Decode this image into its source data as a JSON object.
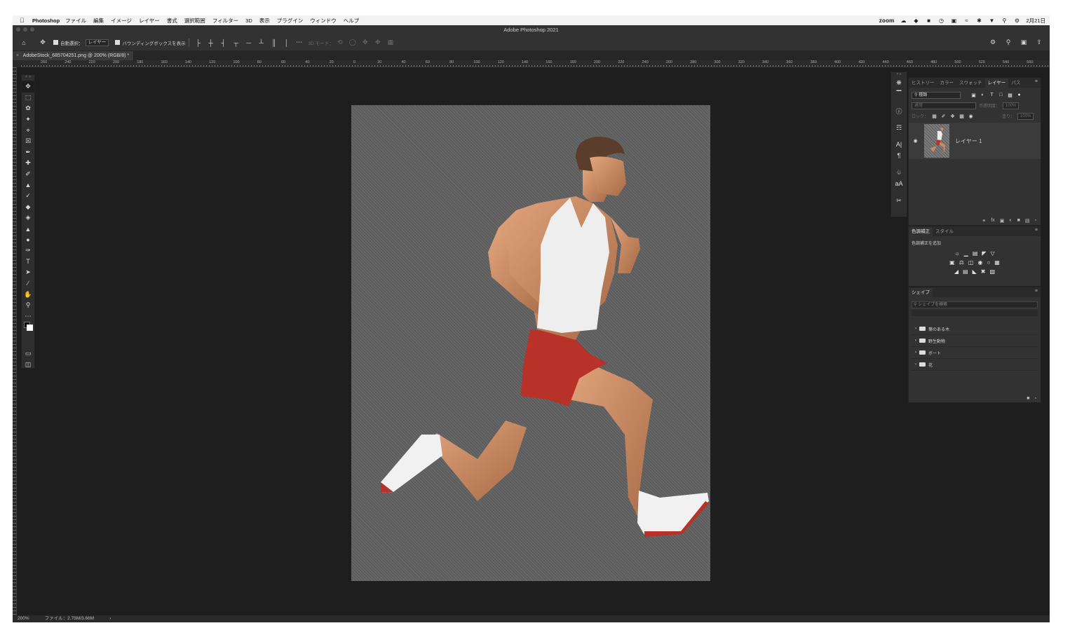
{
  "menubar": {
    "app_name": "Photoshop",
    "items": [
      "ファイル",
      "編集",
      "イメージ",
      "レイヤー",
      "書式",
      "選択範囲",
      "フィルター",
      "3D",
      "表示",
      "プラグイン",
      "ウィンドウ",
      "ヘルプ"
    ],
    "zoom_label": "zoom",
    "clock": "2月21日"
  },
  "window": {
    "title": "Adobe Photoshop 2021"
  },
  "options_bar": {
    "auto_select_label": "自動選択：",
    "auto_select_target": "レイヤー",
    "bounding_box_label": "バウンディングボックスを表示",
    "mode_3d_label": "3D モード："
  },
  "document": {
    "tab_title": "AdobeStock_685704251.png @ 200% (RGB/8) *"
  },
  "rulers": {
    "h_labels": [
      "260",
      "240",
      "220",
      "200",
      "180",
      "160",
      "140",
      "120",
      "100",
      "80",
      "60",
      "40",
      "20",
      "0",
      "20",
      "40",
      "60",
      "80",
      "100",
      "120",
      "140",
      "160",
      "180",
      "200",
      "220",
      "240",
      "260",
      "280",
      "300",
      "320",
      "340",
      "360",
      "380",
      "400",
      "420",
      "440",
      "460",
      "480",
      "500",
      "520",
      "540",
      "560"
    ]
  },
  "layers_panel": {
    "tabs": [
      "ヒストリー",
      "カラー",
      "スウォッチ",
      "レイヤー",
      "パス"
    ],
    "active_tab": "レイヤー",
    "filter_kind": "種類",
    "blend_mode": "通常",
    "opacity_label": "不透明度：",
    "opacity_value": "100%",
    "lock_label": "ロック：",
    "fill_label": "塗り：",
    "fill_value": "100%",
    "layer_name": "レイヤー 1"
  },
  "adjustments_panel": {
    "tabs": [
      "色調補正",
      "スタイル"
    ],
    "label": "色調補正を追加"
  },
  "shapes_panel": {
    "title": "シェイプ",
    "search_placeholder": "シェイプを検索",
    "groups": [
      "葉のある木",
      "野生動物",
      "ボート",
      "花"
    ]
  },
  "status": {
    "zoom": "200%",
    "file_info": "ファイル：2.75M/3.66M"
  },
  "colors": {
    "app_bg": "#1e1e1e",
    "panel_bg": "#323232",
    "shorts": "#b8322a"
  }
}
